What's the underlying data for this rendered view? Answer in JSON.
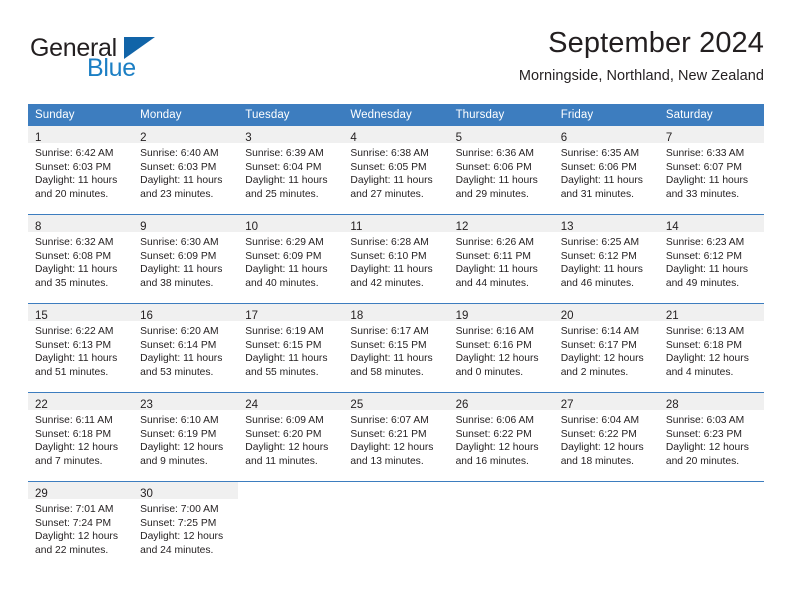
{
  "brand": {
    "name_part1": "General",
    "name_part2": "Blue",
    "flag_icon": "triangle-flag-icon",
    "accent_color": "#1164a8"
  },
  "header": {
    "title": "September 2024",
    "location": "Morningside, Northland, New Zealand"
  },
  "calendar": {
    "header_bg_color": "#3d7dbf",
    "daynum_band_color": "#f0f0f0",
    "weekday_headers": [
      "Sunday",
      "Monday",
      "Tuesday",
      "Wednesday",
      "Thursday",
      "Friday",
      "Saturday"
    ],
    "weeks": [
      [
        {
          "day": "1",
          "sunrise": "Sunrise: 6:42 AM",
          "sunset": "Sunset: 6:03 PM",
          "daylight_line1": "Daylight: 11 hours",
          "daylight_line2": "and 20 minutes."
        },
        {
          "day": "2",
          "sunrise": "Sunrise: 6:40 AM",
          "sunset": "Sunset: 6:03 PM",
          "daylight_line1": "Daylight: 11 hours",
          "daylight_line2": "and 23 minutes."
        },
        {
          "day": "3",
          "sunrise": "Sunrise: 6:39 AM",
          "sunset": "Sunset: 6:04 PM",
          "daylight_line1": "Daylight: 11 hours",
          "daylight_line2": "and 25 minutes."
        },
        {
          "day": "4",
          "sunrise": "Sunrise: 6:38 AM",
          "sunset": "Sunset: 6:05 PM",
          "daylight_line1": "Daylight: 11 hours",
          "daylight_line2": "and 27 minutes."
        },
        {
          "day": "5",
          "sunrise": "Sunrise: 6:36 AM",
          "sunset": "Sunset: 6:06 PM",
          "daylight_line1": "Daylight: 11 hours",
          "daylight_line2": "and 29 minutes."
        },
        {
          "day": "6",
          "sunrise": "Sunrise: 6:35 AM",
          "sunset": "Sunset: 6:06 PM",
          "daylight_line1": "Daylight: 11 hours",
          "daylight_line2": "and 31 minutes."
        },
        {
          "day": "7",
          "sunrise": "Sunrise: 6:33 AM",
          "sunset": "Sunset: 6:07 PM",
          "daylight_line1": "Daylight: 11 hours",
          "daylight_line2": "and 33 minutes."
        }
      ],
      [
        {
          "day": "8",
          "sunrise": "Sunrise: 6:32 AM",
          "sunset": "Sunset: 6:08 PM",
          "daylight_line1": "Daylight: 11 hours",
          "daylight_line2": "and 35 minutes."
        },
        {
          "day": "9",
          "sunrise": "Sunrise: 6:30 AM",
          "sunset": "Sunset: 6:09 PM",
          "daylight_line1": "Daylight: 11 hours",
          "daylight_line2": "and 38 minutes."
        },
        {
          "day": "10",
          "sunrise": "Sunrise: 6:29 AM",
          "sunset": "Sunset: 6:09 PM",
          "daylight_line1": "Daylight: 11 hours",
          "daylight_line2": "and 40 minutes."
        },
        {
          "day": "11",
          "sunrise": "Sunrise: 6:28 AM",
          "sunset": "Sunset: 6:10 PM",
          "daylight_line1": "Daylight: 11 hours",
          "daylight_line2": "and 42 minutes."
        },
        {
          "day": "12",
          "sunrise": "Sunrise: 6:26 AM",
          "sunset": "Sunset: 6:11 PM",
          "daylight_line1": "Daylight: 11 hours",
          "daylight_line2": "and 44 minutes."
        },
        {
          "day": "13",
          "sunrise": "Sunrise: 6:25 AM",
          "sunset": "Sunset: 6:12 PM",
          "daylight_line1": "Daylight: 11 hours",
          "daylight_line2": "and 46 minutes."
        },
        {
          "day": "14",
          "sunrise": "Sunrise: 6:23 AM",
          "sunset": "Sunset: 6:12 PM",
          "daylight_line1": "Daylight: 11 hours",
          "daylight_line2": "and 49 minutes."
        }
      ],
      [
        {
          "day": "15",
          "sunrise": "Sunrise: 6:22 AM",
          "sunset": "Sunset: 6:13 PM",
          "daylight_line1": "Daylight: 11 hours",
          "daylight_line2": "and 51 minutes."
        },
        {
          "day": "16",
          "sunrise": "Sunrise: 6:20 AM",
          "sunset": "Sunset: 6:14 PM",
          "daylight_line1": "Daylight: 11 hours",
          "daylight_line2": "and 53 minutes."
        },
        {
          "day": "17",
          "sunrise": "Sunrise: 6:19 AM",
          "sunset": "Sunset: 6:15 PM",
          "daylight_line1": "Daylight: 11 hours",
          "daylight_line2": "and 55 minutes."
        },
        {
          "day": "18",
          "sunrise": "Sunrise: 6:17 AM",
          "sunset": "Sunset: 6:15 PM",
          "daylight_line1": "Daylight: 11 hours",
          "daylight_line2": "and 58 minutes."
        },
        {
          "day": "19",
          "sunrise": "Sunrise: 6:16 AM",
          "sunset": "Sunset: 6:16 PM",
          "daylight_line1": "Daylight: 12 hours",
          "daylight_line2": "and 0 minutes."
        },
        {
          "day": "20",
          "sunrise": "Sunrise: 6:14 AM",
          "sunset": "Sunset: 6:17 PM",
          "daylight_line1": "Daylight: 12 hours",
          "daylight_line2": "and 2 minutes."
        },
        {
          "day": "21",
          "sunrise": "Sunrise: 6:13 AM",
          "sunset": "Sunset: 6:18 PM",
          "daylight_line1": "Daylight: 12 hours",
          "daylight_line2": "and 4 minutes."
        }
      ],
      [
        {
          "day": "22",
          "sunrise": "Sunrise: 6:11 AM",
          "sunset": "Sunset: 6:18 PM",
          "daylight_line1": "Daylight: 12 hours",
          "daylight_line2": "and 7 minutes."
        },
        {
          "day": "23",
          "sunrise": "Sunrise: 6:10 AM",
          "sunset": "Sunset: 6:19 PM",
          "daylight_line1": "Daylight: 12 hours",
          "daylight_line2": "and 9 minutes."
        },
        {
          "day": "24",
          "sunrise": "Sunrise: 6:09 AM",
          "sunset": "Sunset: 6:20 PM",
          "daylight_line1": "Daylight: 12 hours",
          "daylight_line2": "and 11 minutes."
        },
        {
          "day": "25",
          "sunrise": "Sunrise: 6:07 AM",
          "sunset": "Sunset: 6:21 PM",
          "daylight_line1": "Daylight: 12 hours",
          "daylight_line2": "and 13 minutes."
        },
        {
          "day": "26",
          "sunrise": "Sunrise: 6:06 AM",
          "sunset": "Sunset: 6:22 PM",
          "daylight_line1": "Daylight: 12 hours",
          "daylight_line2": "and 16 minutes."
        },
        {
          "day": "27",
          "sunrise": "Sunrise: 6:04 AM",
          "sunset": "Sunset: 6:22 PM",
          "daylight_line1": "Daylight: 12 hours",
          "daylight_line2": "and 18 minutes."
        },
        {
          "day": "28",
          "sunrise": "Sunrise: 6:03 AM",
          "sunset": "Sunset: 6:23 PM",
          "daylight_line1": "Daylight: 12 hours",
          "daylight_line2": "and 20 minutes."
        }
      ],
      [
        {
          "day": "29",
          "sunrise": "Sunrise: 7:01 AM",
          "sunset": "Sunset: 7:24 PM",
          "daylight_line1": "Daylight: 12 hours",
          "daylight_line2": "and 22 minutes."
        },
        {
          "day": "30",
          "sunrise": "Sunrise: 7:00 AM",
          "sunset": "Sunset: 7:25 PM",
          "daylight_line1": "Daylight: 12 hours",
          "daylight_line2": "and 24 minutes."
        },
        {
          "day": "",
          "sunrise": "",
          "sunset": "",
          "daylight_line1": "",
          "daylight_line2": ""
        },
        {
          "day": "",
          "sunrise": "",
          "sunset": "",
          "daylight_line1": "",
          "daylight_line2": ""
        },
        {
          "day": "",
          "sunrise": "",
          "sunset": "",
          "daylight_line1": "",
          "daylight_line2": ""
        },
        {
          "day": "",
          "sunrise": "",
          "sunset": "",
          "daylight_line1": "",
          "daylight_line2": ""
        },
        {
          "day": "",
          "sunrise": "",
          "sunset": "",
          "daylight_line1": "",
          "daylight_line2": ""
        }
      ]
    ]
  }
}
